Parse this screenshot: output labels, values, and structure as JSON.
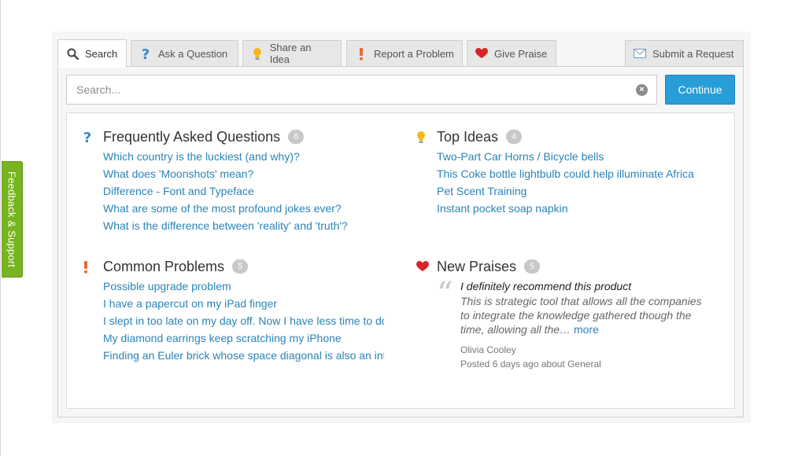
{
  "feedback_tab": {
    "label": "Feedback & Support"
  },
  "tabs": [
    {
      "label": "Search",
      "icon": "search-icon",
      "active": true
    },
    {
      "label": "Ask a Question",
      "icon": "question-icon",
      "active": false
    },
    {
      "label": "Share an Idea",
      "icon": "lightbulb-icon",
      "active": false
    },
    {
      "label": "Report a Problem",
      "icon": "exclamation-icon",
      "active": false
    },
    {
      "label": "Give Praise",
      "icon": "heart-icon",
      "active": false
    },
    {
      "label": "Submit a Request",
      "icon": "envelope-icon",
      "active": false
    }
  ],
  "search": {
    "placeholder": "Search...",
    "value": "",
    "continue_label": "Continue"
  },
  "faq": {
    "title": "Frequently Asked Questions",
    "count": "6",
    "items": [
      "Which country is the luckiest (and why)?",
      "What does 'Moonshots' mean?",
      "Difference - Font and Typeface",
      "What are some of the most profound jokes ever?",
      "What is the difference between 'reality' and 'truth'?"
    ]
  },
  "ideas": {
    "title": "Top Ideas",
    "count": "4",
    "items": [
      "Two-Part Car Horns / Bicycle bells",
      "This Coke bottle lightbulb could help illuminate Africa",
      "Pet Scent Training",
      "Instant pocket soap napkin"
    ]
  },
  "problems": {
    "title": "Common Problems",
    "count": "5",
    "items": [
      "Possible upgrade problem",
      "I have a papercut on my iPad finger",
      "I slept in too late on my day off. Now I have less time to do",
      "My diamond earrings keep scratching my iPhone",
      "Finding an Euler brick whose space diagonal is also an integer"
    ]
  },
  "praises": {
    "title": "New Praises",
    "count": "5",
    "quote_title": "I definitely recommend this product",
    "quote_text": "This is strategic tool that allows all the companies to integrate the knowledge gathered though the time, allowing all the…",
    "more_label": "more",
    "author": "Olivia Cooley",
    "meta": "Posted 6 days ago about General"
  },
  "colors": {
    "accent": "#279ed8",
    "link": "#2a84b8",
    "feedback_green": "#77b41e",
    "question_blue": "#3a87d0",
    "idea_yellow": "#f3b91a",
    "problem_orange": "#e86a3a",
    "praise_red": "#d8232a"
  }
}
